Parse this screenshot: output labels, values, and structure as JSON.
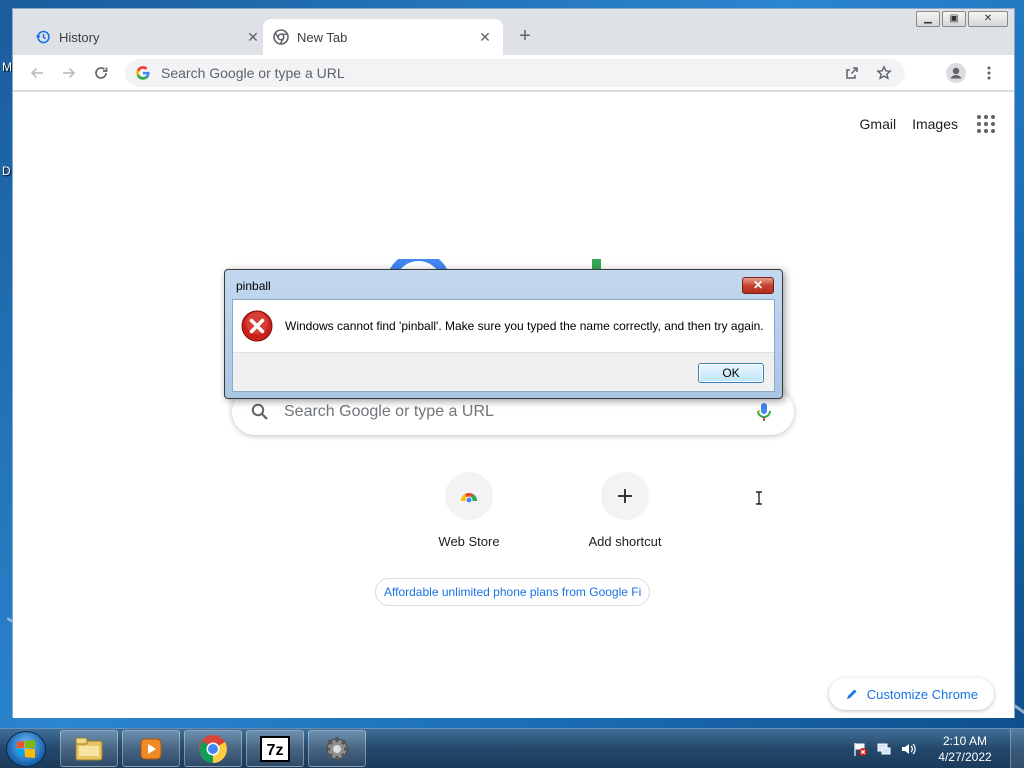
{
  "desktop": {
    "letters": [
      "M",
      "D"
    ]
  },
  "browser": {
    "tabs": [
      {
        "label": "History",
        "icon": "history-icon",
        "active": false
      },
      {
        "label": "New Tab",
        "icon": "chrome-icon",
        "active": true
      }
    ],
    "window_controls": {
      "minimize": "▁",
      "maximize": "▣",
      "close": "✕"
    },
    "omnibox": {
      "placeholder": "Search Google or type a URL"
    }
  },
  "page": {
    "top_links": {
      "gmail": "Gmail",
      "images": "Images"
    },
    "search": {
      "placeholder": "Search Google or type a URL"
    },
    "shortcuts": [
      {
        "label": "Web Store",
        "icon": "web-store-icon"
      },
      {
        "label": "Add shortcut",
        "icon": "plus-icon"
      }
    ],
    "promo": "Affordable unlimited phone plans from Google Fi",
    "customize": "Customize Chrome"
  },
  "dialog": {
    "title": "pinball",
    "close": "✕",
    "message": "Windows cannot find 'pinball'. Make sure you typed the name correctly, and then try again.",
    "ok": "OK"
  },
  "taskbar": {
    "items": [
      "file-explorer-icon",
      "media-player-icon",
      "chrome-icon",
      "7zip-icon",
      "settings-gear-icon"
    ],
    "clock": {
      "time": "2:10 AM",
      "date": "4/27/2022"
    }
  }
}
